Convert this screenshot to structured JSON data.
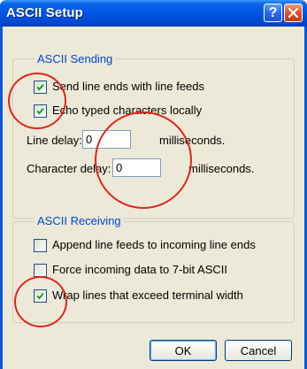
{
  "window": {
    "title": "ASCII Setup",
    "help_label": "?",
    "close_icon": "close-icon"
  },
  "ascii_sending": {
    "legend": "ASCII Sending",
    "send_line_ends": {
      "label": "Send line ends with line feeds",
      "checked": true
    },
    "echo_typed": {
      "label": "Echo typed characters locally",
      "checked": true
    },
    "line_delay": {
      "label": "Line delay:",
      "value": "0",
      "unit": "milliseconds."
    },
    "character_delay": {
      "label": "Character delay:",
      "value": "0",
      "unit": "milliseconds."
    }
  },
  "ascii_receiving": {
    "legend": "ASCII Receiving",
    "append_line_feeds": {
      "label": "Append line feeds to incoming line ends",
      "checked": false
    },
    "force_7bit": {
      "label": "Force incoming data to 7-bit ASCII",
      "checked": false
    },
    "wrap_lines": {
      "label": "Wrap lines that exceed terminal width",
      "checked": true
    }
  },
  "buttons": {
    "ok": "OK",
    "cancel": "Cancel"
  },
  "annotation_color": "#e0251b"
}
